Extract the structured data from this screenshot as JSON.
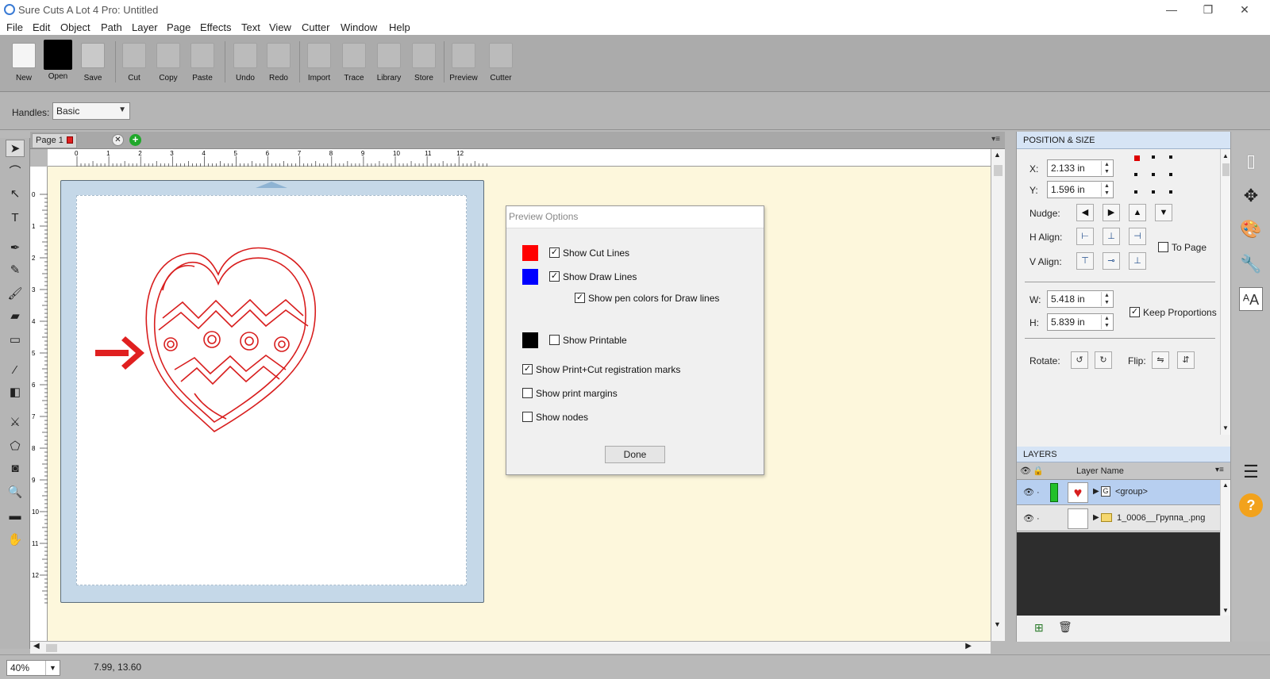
{
  "window": {
    "title": "Sure Cuts A Lot 4 Pro: Untitled",
    "minimize": "—",
    "restore": "❐",
    "close": "✕"
  },
  "menu": [
    "File",
    "Edit",
    "Object",
    "Path",
    "Layer",
    "Page",
    "Effects",
    "Text",
    "View",
    "Cutter",
    "Window",
    "Help"
  ],
  "toolbar": [
    {
      "label": "New",
      "icon": "new-document-icon"
    },
    {
      "label": "Open",
      "icon": "open-folder-icon"
    },
    {
      "label": "Save",
      "icon": "save-floppy-icon"
    },
    {
      "label": "Cut",
      "icon": "scissors-icon"
    },
    {
      "label": "Copy",
      "icon": "copy-icon"
    },
    {
      "label": "Paste",
      "icon": "paste-icon"
    },
    {
      "label": "Undo",
      "icon": "undo-icon"
    },
    {
      "label": "Redo",
      "icon": "redo-icon"
    },
    {
      "label": "Import",
      "icon": "import-icon"
    },
    {
      "label": "Trace",
      "icon": "trace-icon"
    },
    {
      "label": "Library",
      "icon": "library-icon"
    },
    {
      "label": "Store",
      "icon": "store-icon"
    },
    {
      "label": "Preview",
      "icon": "preview-icon"
    },
    {
      "label": "Cutter",
      "icon": "cutter-icon"
    }
  ],
  "propbar": {
    "handles_label": "Handles:",
    "handles_value": "Basic"
  },
  "page_tab": {
    "label": "Page 1"
  },
  "ruler": {
    "h_ticks": [
      "0",
      "1",
      "2",
      "3",
      "4",
      "5",
      "6",
      "7",
      "8",
      "9",
      "10",
      "11",
      "12"
    ],
    "v_ticks": [
      "0",
      "1",
      "2",
      "3",
      "4",
      "5",
      "6",
      "7",
      "8",
      "9",
      "10",
      "11",
      "12"
    ]
  },
  "preview_dialog": {
    "title": "Preview Options",
    "options": [
      {
        "label": "Show Cut Lines",
        "checked": true,
        "swatch": "#ff0000"
      },
      {
        "label": "Show Draw Lines",
        "checked": true,
        "swatch": "#0000ff"
      },
      {
        "label": "Show pen colors for Draw lines",
        "checked": true
      },
      {
        "label": "Show Printable",
        "checked": false,
        "swatch": "#000000"
      },
      {
        "label": "Show Print+Cut registration marks",
        "checked": true
      },
      {
        "label": "Show print margins",
        "checked": false
      },
      {
        "label": "Show nodes",
        "checked": false
      }
    ],
    "done": "Done"
  },
  "position_size": {
    "header": "POSITION & SIZE",
    "x_label": "X:",
    "x_value": "2.133 in",
    "y_label": "Y:",
    "y_value": "1.596 in",
    "nudge_label": "Nudge:",
    "halign_label": "H Align:",
    "valign_label": "V Align:",
    "to_page_label": "To Page",
    "to_page_checked": false,
    "w_label": "W:",
    "w_value": "5.418 in",
    "h_label": "H:",
    "h_value": "5.839 in",
    "keep_proportions": "Keep Proportions",
    "keep_checked": true,
    "rotate_label": "Rotate:",
    "flip_label": "Flip:"
  },
  "layers": {
    "header": "LAYERS",
    "col_name": "Layer Name",
    "rows": [
      {
        "name": "<group>",
        "type_badge": "G",
        "swatch": "#22c02a"
      },
      {
        "name": "1_0006__Группа_.png"
      }
    ]
  },
  "status": {
    "zoom": "40%",
    "coords": "7.99, 13.60"
  },
  "colors": {
    "accent": "#d6e4f5",
    "cut_line": "#d81e1e",
    "canvas_bg": "#fdf7dc",
    "mat": "#c5d8e8"
  }
}
